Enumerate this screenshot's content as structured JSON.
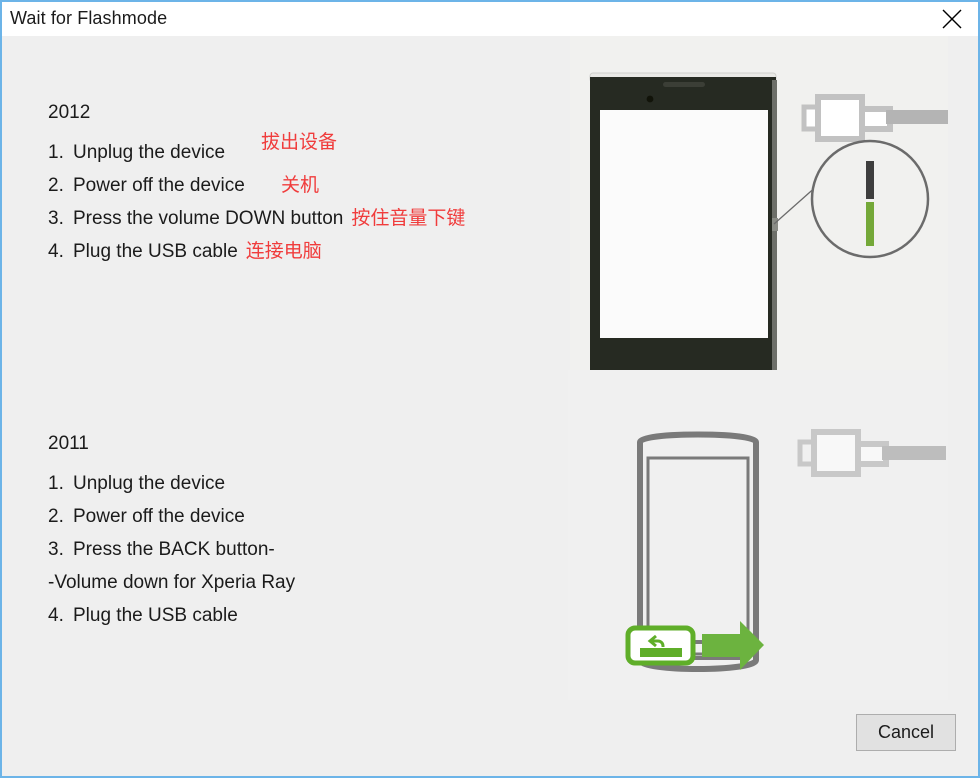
{
  "window": {
    "title": "Wait for Flashmode",
    "close_icon": "close-icon",
    "accent_border": "#6cb4e8",
    "background": "#efefef",
    "titlebar_background": "#ffffff"
  },
  "instructions": {
    "groups": [
      {
        "year": "2012",
        "steps": [
          {
            "num": "1.",
            "en": "Unplug the device",
            "cn": "拔出设备"
          },
          {
            "num": "2.",
            "en": "Power off the device",
            "cn": "关机"
          },
          {
            "num": "3.",
            "en": "Press the volume DOWN button",
            "cn": "按住音量下键"
          },
          {
            "num": "4.",
            "en": "Plug the USB cable",
            "cn": "连接电脑"
          }
        ],
        "subline": ""
      },
      {
        "year": "2011",
        "steps": [
          {
            "num": "1.",
            "en": "Unplug the device",
            "cn": ""
          },
          {
            "num": "2.",
            "en": "Power off the device",
            "cn": ""
          },
          {
            "num": "3.",
            "en": "Press the BACK button-",
            "cn": ""
          },
          {
            "num": "4.",
            "en": "Plug the USB cable",
            "cn": ""
          }
        ],
        "subline": "-Volume down for Xperia Ray"
      }
    ],
    "annotation_color": "#f03c3c",
    "text_color": "#1b1b1b"
  },
  "illustrations": {
    "top": {
      "name": "xperia-2012-volume-down-illustration",
      "phone_body_color": "#262a22",
      "phone_screen_color": "#fbfbfb",
      "cable_color": "#b4b4b4",
      "callout_highlight_color": "#74a838",
      "callout_dark_color": "#3e3e3e",
      "caption": "Phone with USB cable and magnified volume-down button"
    },
    "bottom": {
      "name": "xperia-2011-back-button-illustration",
      "outline_color": "#7a7a7a",
      "cable_color": "#bdbdbd",
      "highlight_color": "#5fae29",
      "caption": "Phone outline with BACK button highlighted and arrow"
    }
  },
  "footer": {
    "cancel_label": "Cancel"
  }
}
